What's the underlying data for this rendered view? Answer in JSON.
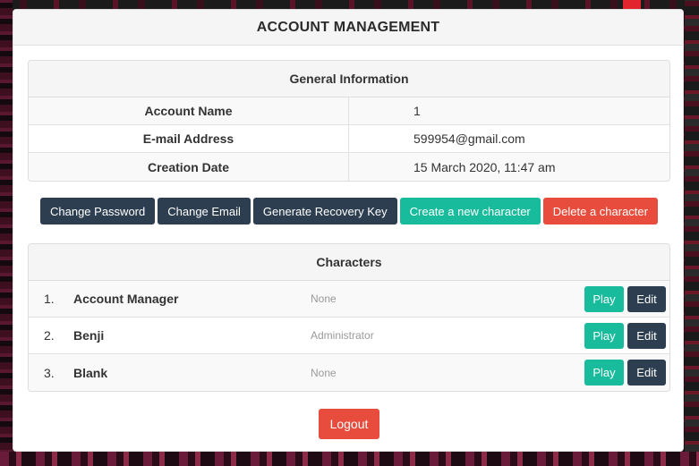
{
  "page": {
    "title": "ACCOUNT MANAGEMENT"
  },
  "general": {
    "heading": "General Information",
    "rows": [
      {
        "key": "Account Name",
        "value": "1"
      },
      {
        "key": "E-mail Address",
        "value": "599954@gmail.com"
      },
      {
        "key": "Creation Date",
        "value": "15 March 2020, 11:47 am"
      }
    ]
  },
  "actions": {
    "change_password": "Change Password",
    "change_email": "Change Email",
    "generate_recovery_key": "Generate Recovery Key",
    "create_character": "Create a new character",
    "delete_character": "Delete a character"
  },
  "characters": {
    "heading": "Characters",
    "play_label": "Play",
    "edit_label": "Edit",
    "rows": [
      {
        "num": "1.",
        "name": "Account Manager",
        "role": "None"
      },
      {
        "num": "2.",
        "name": "Benji",
        "role": "Administrator"
      },
      {
        "num": "3.",
        "name": "Blank",
        "role": "None"
      }
    ]
  },
  "footer": {
    "logout": "Logout"
  },
  "colors": {
    "dark": "#2c3e50",
    "teal": "#18bc9c",
    "red": "#e74c3c"
  }
}
